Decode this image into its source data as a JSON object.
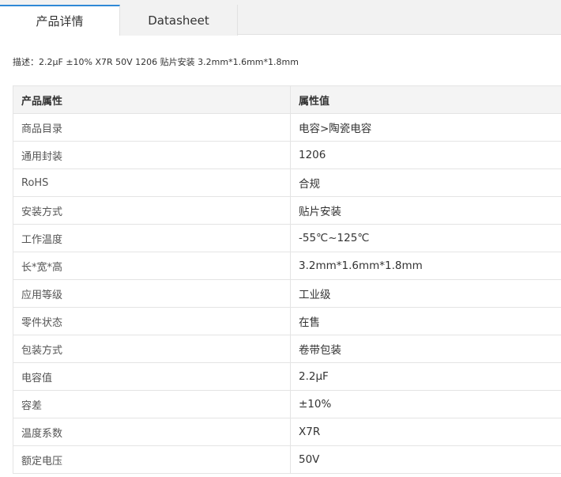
{
  "tabs": [
    {
      "label": "产品详情",
      "active": true
    },
    {
      "label": "Datasheet",
      "active": false
    }
  ],
  "accent_color": "#2f89d6",
  "description": "描述：2.2μF ±10% X7R 50V 1206 贴片安装 3.2mm*1.6mm*1.8mm",
  "table": {
    "headers": [
      "产品属性",
      "属性值"
    ],
    "rows": [
      [
        "商品目录",
        "电容>陶瓷电容"
      ],
      [
        "通用封装",
        "1206"
      ],
      [
        "RoHS",
        "合规"
      ],
      [
        "安装方式",
        "贴片安装"
      ],
      [
        "工作温度",
        "-55℃~125℃"
      ],
      [
        "长*宽*高",
        "3.2mm*1.6mm*1.8mm"
      ],
      [
        "应用等级",
        "工业级"
      ],
      [
        "零件状态",
        "在售"
      ],
      [
        "包装方式",
        "卷带包装"
      ],
      [
        "电容值",
        "2.2μF"
      ],
      [
        "容差",
        "±10%"
      ],
      [
        "温度系数",
        "X7R"
      ],
      [
        "额定电压",
        "50V"
      ]
    ]
  }
}
